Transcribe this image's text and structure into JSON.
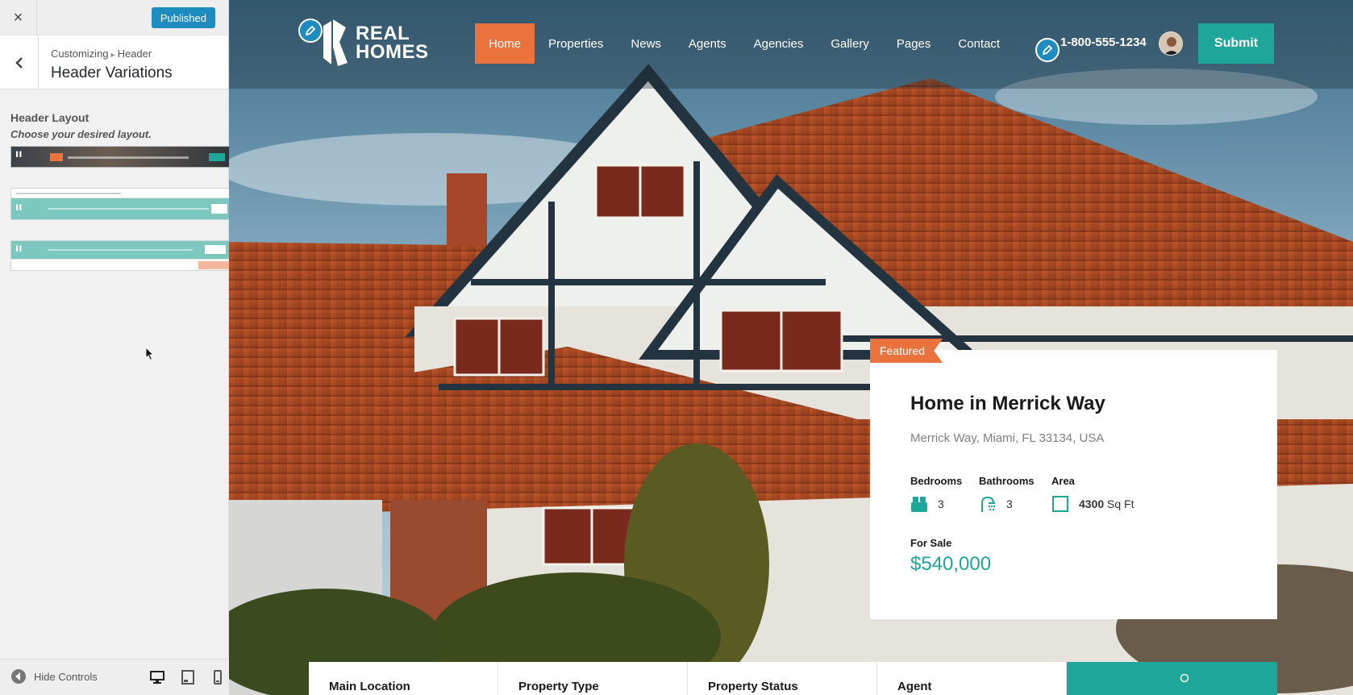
{
  "customizer": {
    "close_label": "×",
    "publish_button": "Published",
    "breadcrumb": {
      "parent": "Customizing",
      "separator": "▸",
      "section": "Header"
    },
    "section_title": "Header Variations",
    "control": {
      "label": "Header Layout",
      "description": "Choose your desired layout.",
      "options": [
        "layout-1",
        "layout-2",
        "layout-3"
      ],
      "selected": 0
    },
    "footer": {
      "hide_controls": "Hide Controls",
      "devices": [
        "desktop",
        "tablet",
        "mobile"
      ]
    }
  },
  "site": {
    "logo_text_1": "REAL",
    "logo_text_2": "HOMES",
    "nav": [
      "Home",
      "Properties",
      "News",
      "Agents",
      "Agencies",
      "Gallery",
      "Pages",
      "Contact"
    ],
    "active_nav": "Home",
    "phone": "1-800-555-1234",
    "submit_label": "Submit",
    "colors": {
      "accent_orange": "#ea723d",
      "accent_teal": "#1ea69a",
      "edit_blue": "#1e8cbe"
    }
  },
  "featured": {
    "badge": "Featured",
    "title": "Home in Merrick Way",
    "address": "Merrick Way, Miami, FL 33134, USA",
    "bedrooms_label": "Bedrooms",
    "bedrooms": "3",
    "bathrooms_label": "Bathrooms",
    "bathrooms": "3",
    "area_label": "Area",
    "area_value": "4300",
    "area_unit": "Sq Ft",
    "status": "For Sale",
    "price": "$540,000"
  },
  "search": {
    "fields": [
      "Main Location",
      "Property Type",
      "Property Status",
      "Agent"
    ]
  }
}
